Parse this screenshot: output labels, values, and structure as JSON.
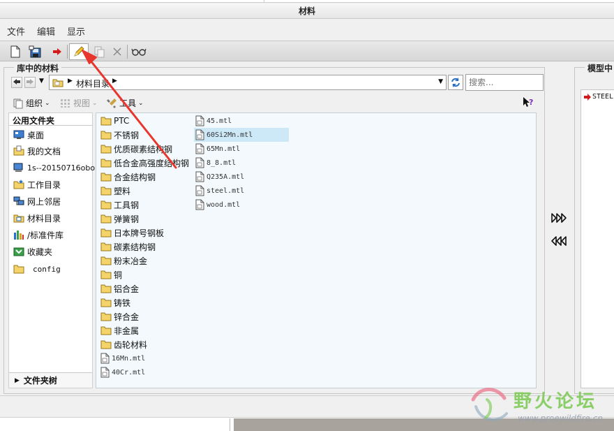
{
  "window": {
    "title": "材料"
  },
  "menu": {
    "items": [
      "文件",
      "编辑",
      "显示"
    ]
  },
  "library_panel": {
    "title": "库中的材料",
    "address": {
      "path": "材料目录"
    },
    "search": {
      "placeholder": "搜索..."
    },
    "toolbar": {
      "organize": "组织",
      "view": "视图",
      "tools": "工具"
    },
    "sidebar": {
      "header": "公用文件夹",
      "items": [
        {
          "label": "桌面",
          "icon": "desktop-icon"
        },
        {
          "label": "我的文档",
          "icon": "documents-icon"
        },
        {
          "label": "1s--20150716obo",
          "icon": "computer-icon"
        },
        {
          "label": "工作目录",
          "icon": "work-folder-icon"
        },
        {
          "label": "网上邻居",
          "icon": "network-icon"
        },
        {
          "label": "材料目录",
          "icon": "material-folder-icon"
        },
        {
          "label": "/标准件库",
          "icon": "library-icon"
        },
        {
          "label": "收藏夹",
          "icon": "favorites-icon"
        },
        {
          "label": "config",
          "icon": "folder-icon"
        }
      ],
      "tree_label": "文件夹树"
    },
    "files": {
      "column1": [
        {
          "name": "PTC",
          "type": "folder"
        },
        {
          "name": "不锈钢",
          "type": "folder"
        },
        {
          "name": "优质碳素结构钢",
          "type": "folder"
        },
        {
          "name": "低合金高强度结构钢",
          "type": "folder"
        },
        {
          "name": "合金结构钢",
          "type": "folder"
        },
        {
          "name": "塑料",
          "type": "folder"
        },
        {
          "name": "工具钢",
          "type": "folder"
        },
        {
          "name": "弹簧钢",
          "type": "folder"
        },
        {
          "name": "日本牌号钢板",
          "type": "folder"
        },
        {
          "name": "碳素结构钢",
          "type": "folder"
        },
        {
          "name": "粉末冶金",
          "type": "folder"
        },
        {
          "name": "铜",
          "type": "folder"
        },
        {
          "name": "铝合金",
          "type": "folder"
        },
        {
          "name": "铸铁",
          "type": "folder"
        },
        {
          "name": "锌合金",
          "type": "folder"
        },
        {
          "name": "非金属",
          "type": "folder"
        },
        {
          "name": "齿轮材料",
          "type": "folder"
        },
        {
          "name": "16Mn.mtl",
          "type": "file"
        },
        {
          "name": "40Cr.mtl",
          "type": "file"
        }
      ],
      "column2": [
        {
          "name": "45.mtl",
          "type": "file"
        },
        {
          "name": "60Si2Mn.mtl",
          "type": "file",
          "selected": true
        },
        {
          "name": "65Mn.mtl",
          "type": "file"
        },
        {
          "name": "8_8.mtl",
          "type": "file"
        },
        {
          "name": "Q235A.mtl",
          "type": "file"
        },
        {
          "name": "steel.mtl",
          "type": "file"
        },
        {
          "name": "wood.mtl",
          "type": "file"
        }
      ]
    }
  },
  "model_panel": {
    "title": "模型中",
    "items": [
      {
        "name": "STEEL"
      }
    ]
  },
  "watermark": {
    "title": "野火论坛",
    "url": "www.proewildfire.cn"
  },
  "colors": {
    "selection": "#cde8f7",
    "annotation_arrow": "#e8352e",
    "folder": "#f4d36b",
    "accent_red": "#d11a1a"
  }
}
